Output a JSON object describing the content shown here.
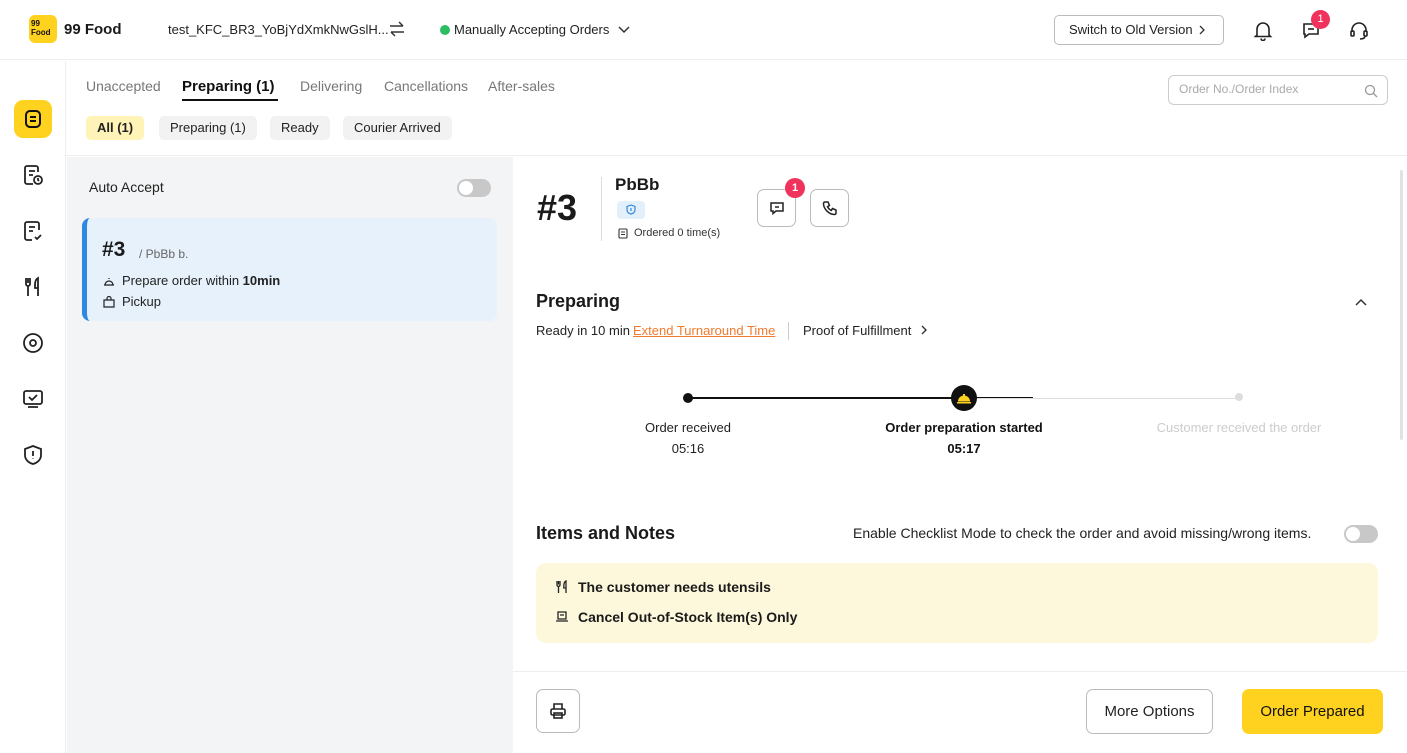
{
  "header": {
    "logo_mark": "99 Food",
    "app_name": "99 Food",
    "store_name": "test_KFC_BR3_YoBjYdXmkNwGslH...",
    "order_status": "Manually Accepting Orders",
    "switch_version_label": "Switch to Old Version",
    "messages_badge": "1"
  },
  "tabs": [
    {
      "label": "Unaccepted"
    },
    {
      "label": "Preparing (1)"
    },
    {
      "label": "Delivering"
    },
    {
      "label": "Cancellations"
    },
    {
      "label": "After-sales"
    }
  ],
  "filters": [
    {
      "label": "All (1)"
    },
    {
      "label": "Preparing (1)"
    },
    {
      "label": "Ready"
    },
    {
      "label": "Courier Arrived"
    }
  ],
  "search": {
    "placeholder": "Order No./Order Index",
    "value": ""
  },
  "order_list": {
    "auto_accept_label": "Auto Accept",
    "auto_accept_enabled": false,
    "orders": [
      {
        "number": "#3",
        "customer": "/ PbBb b.",
        "prepare_prefix": "Prepare order within ",
        "prepare_time": "10min",
        "type": "Pickup"
      }
    ]
  },
  "order_detail": {
    "number": "#3",
    "customer_name": "PbBb",
    "ordered_times": "Ordered 0 time(s)",
    "chat_badge": "1",
    "status_title": "Preparing",
    "ready_text": "Ready in 10 min",
    "extend_label": "Extend Turnaround Time",
    "proof_label": "Proof of Fulfillment",
    "timeline": [
      {
        "label": "Order received",
        "time": "05:16",
        "state": "done"
      },
      {
        "label": "Order preparation started",
        "time": "05:17",
        "state": "current"
      },
      {
        "label": "Customer received the order",
        "time": "",
        "state": "pending"
      }
    ],
    "items_title": "Items and Notes",
    "checklist_text": "Enable Checklist Mode to check the order and avoid missing/wrong items.",
    "checklist_enabled": false,
    "notes": [
      {
        "icon": "utensils-icon",
        "text": "The customer needs utensils"
      },
      {
        "icon": "cancel-items-icon",
        "text": "Cancel Out-of-Stock Item(s) Only"
      }
    ]
  },
  "footer": {
    "more_options_label": "More Options",
    "order_prepared_label": "Order Prepared"
  },
  "colors": {
    "brand_yellow": "#ffd21f",
    "badge_pink": "#f0335c",
    "link_orange": "#f07a2e",
    "active_blue": "#2f89e0",
    "status_green": "#2dbd62"
  }
}
